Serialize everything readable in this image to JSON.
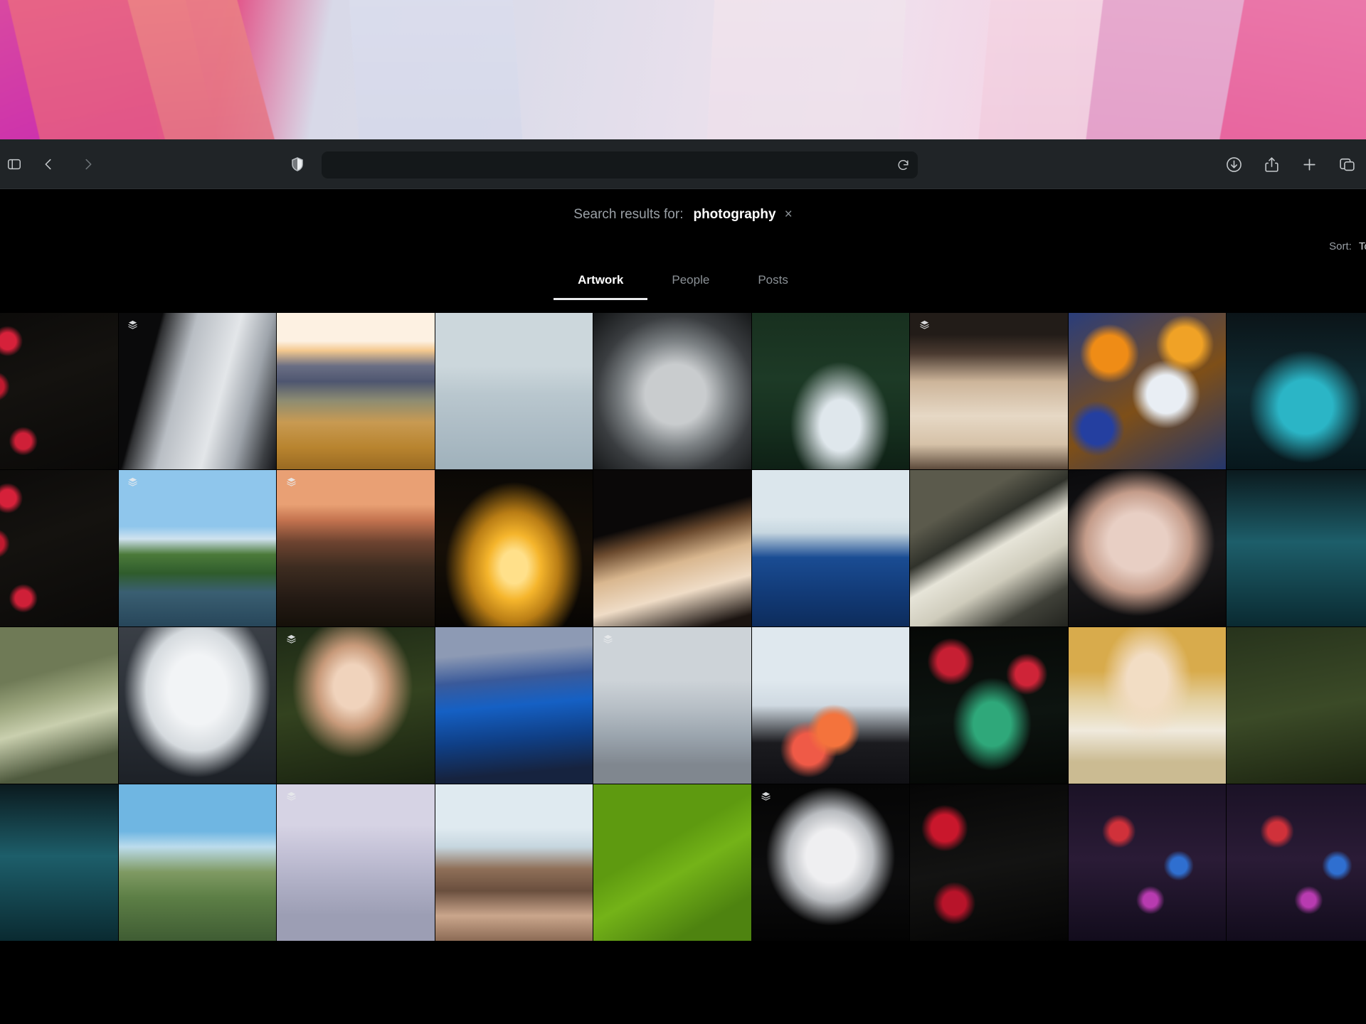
{
  "browser": {
    "toolbar": {
      "sidebar_icon": "sidebar-icon",
      "back_icon": "chevron-left-icon",
      "forward_icon": "chevron-right-icon",
      "shield_icon": "shield-privacy-icon",
      "url_value": "",
      "url_placeholder": "",
      "reload_icon": "reload-icon",
      "downloads_icon": "download-icon",
      "share_icon": "share-icon",
      "new_tab_icon": "plus-icon",
      "tab_overview_icon": "tab-overview-icon"
    }
  },
  "search": {
    "label": "Search results for:",
    "term": "photography",
    "clear_symbol": "×"
  },
  "sort": {
    "label": "Sort:",
    "value": "Top"
  },
  "tabs": [
    {
      "label": "Artwork",
      "active": true
    },
    {
      "label": "People",
      "active": false
    },
    {
      "label": "Posts",
      "active": false
    }
  ],
  "grid": {
    "badge_icon": "stack-layers-icon",
    "tiles": [
      {
        "name": "artwork-roses-dark",
        "art": "a-roses",
        "badge": false
      },
      {
        "name": "artwork-photographer-camera",
        "art": "a-photog",
        "badge": true
      },
      {
        "name": "artwork-dolomites-sunrise",
        "art": "a-dolomite",
        "badge": false
      },
      {
        "name": "artwork-woman-black-gown-sea",
        "art": "a-blackgown",
        "badge": false
      },
      {
        "name": "artwork-galloping-horses-mist",
        "art": "a-horses",
        "badge": false
      },
      {
        "name": "artwork-woman-green-pool-gown",
        "art": "a-greenpool",
        "badge": false
      },
      {
        "name": "artwork-bazaar-magazine-cover",
        "art": "a-bazaar",
        "badge": true
      },
      {
        "name": "artwork-marigold-flower-portrait",
        "art": "a-marigold",
        "badge": false
      },
      {
        "name": "artwork-mermaid-teal-edge",
        "art": "a-mermaid",
        "badge": false
      },
      {
        "name": "artwork-roses-frame-left",
        "art": "a-roses",
        "badge": false
      },
      {
        "name": "artwork-lakeside-cottage",
        "art": "a-cottage",
        "badge": true
      },
      {
        "name": "artwork-dusk-forest-fire",
        "art": "a-dusk",
        "badge": true
      },
      {
        "name": "artwork-golden-candle-madonna",
        "art": "a-candle",
        "badge": false
      },
      {
        "name": "artwork-braided-hair-profile",
        "art": "a-braid",
        "badge": false
      },
      {
        "name": "artwork-blue-turtleneck-rose",
        "art": "a-blueturtle",
        "badge": false
      },
      {
        "name": "artwork-woman-ruined-window",
        "art": "a-window",
        "badge": false
      },
      {
        "name": "artwork-red-lips-closeup",
        "art": "a-redlips",
        "badge": false
      },
      {
        "name": "artwork-cyan-sliver",
        "art": "a-cyan-left",
        "badge": false
      },
      {
        "name": "artwork-green-sleeve-hand",
        "art": "a-greensleeve",
        "badge": false
      },
      {
        "name": "artwork-white-petal-sculpture",
        "art": "a-petals",
        "badge": false
      },
      {
        "name": "artwork-girl-green-backdrop",
        "art": "a-girlgreen",
        "badge": true
      },
      {
        "name": "artwork-blue-hair-jewel",
        "art": "a-bluehair",
        "badge": false
      },
      {
        "name": "artwork-sword-fog-figure",
        "art": "a-sword",
        "badge": true
      },
      {
        "name": "artwork-floral-kimono-portrait",
        "art": "a-flowerkimono",
        "badge": false
      },
      {
        "name": "artwork-green-hair-mermaid-roses",
        "art": "a-greenmer",
        "badge": false
      },
      {
        "name": "artwork-golden-hair-maiden",
        "art": "a-goldgirl",
        "badge": false
      },
      {
        "name": "artwork-deep-green-sliver",
        "art": "a-deepgreen",
        "badge": false
      },
      {
        "name": "artwork-dark-horse-left",
        "art": "a-cyan-left",
        "badge": false
      },
      {
        "name": "artwork-knight-on-horse-meadow",
        "art": "a-knight",
        "badge": false
      },
      {
        "name": "artwork-fog-standing-figure",
        "art": "a-fogfigure",
        "badge": true
      },
      {
        "name": "artwork-sea-of-clouds-peaks",
        "art": "a-seamount",
        "badge": false
      },
      {
        "name": "artwork-green-backdrop-profile",
        "art": "a-greenbg",
        "badge": false
      },
      {
        "name": "artwork-white-hair-circle",
        "art": "a-whitehair",
        "badge": true
      },
      {
        "name": "artwork-dark-flowers-portrait",
        "art": "a-darkflower",
        "badge": false
      },
      {
        "name": "artwork-neon-street-night",
        "art": "a-neon",
        "badge": false
      },
      {
        "name": "artwork-neon-edge-right",
        "art": "a-neon",
        "badge": false
      }
    ]
  }
}
